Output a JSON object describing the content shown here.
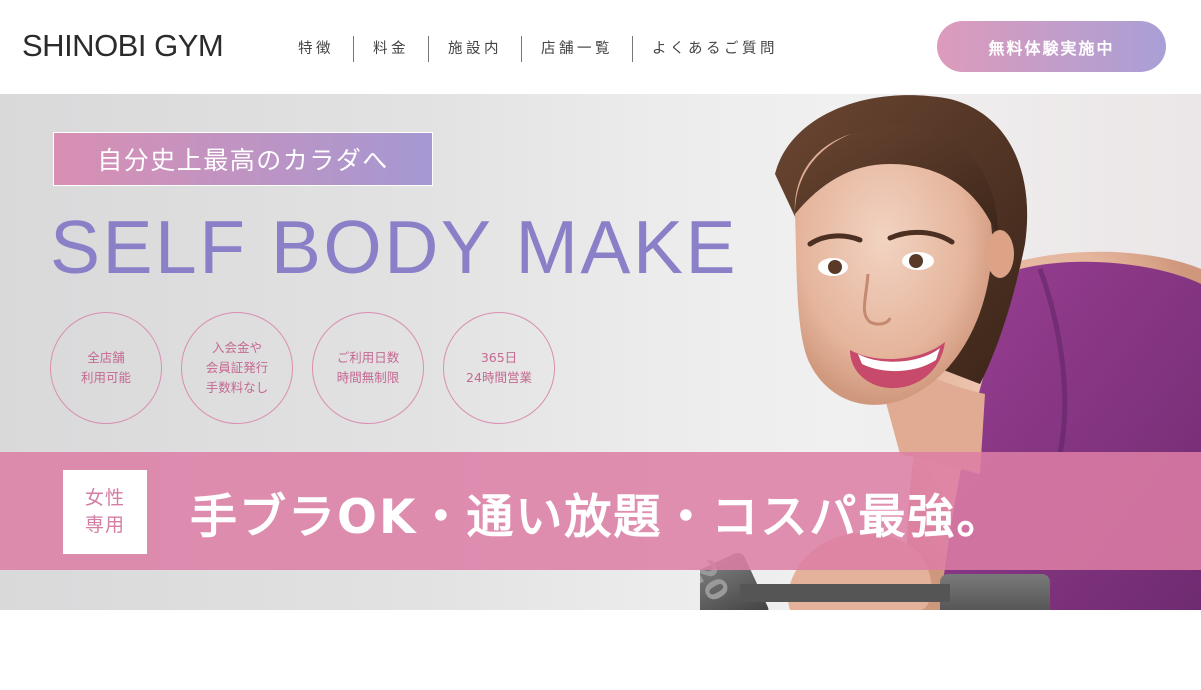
{
  "header": {
    "logo": "SHINOBI GYM",
    "nav": [
      "特徴",
      "料金",
      "施設内",
      "店舗一覧",
      "よくあるご質問"
    ],
    "cta_label": "無料体験実施中"
  },
  "hero": {
    "tagline": "自分史上最高のカラダへ",
    "headline": "SELF BODY MAKE",
    "badges": [
      {
        "lines": [
          "全店舗",
          "利用可能"
        ]
      },
      {
        "lines": [
          "入会金や",
          "会員証発行",
          "手数料なし"
        ]
      },
      {
        "lines": [
          "ご利用日数",
          "時間無制限"
        ]
      },
      {
        "lines": [
          "365日",
          "24時間営業"
        ]
      }
    ],
    "women_only": [
      "女性",
      "専用"
    ],
    "band_text": "手ブラOK・通い放題・コスパ最強。",
    "dumbbell_label": "20"
  },
  "colors": {
    "accent_pink": "#dd7ea5",
    "accent_purple": "#8a80c8",
    "cta_gradient_start": "#dd9bbb",
    "cta_gradient_end": "#a99fd6"
  }
}
